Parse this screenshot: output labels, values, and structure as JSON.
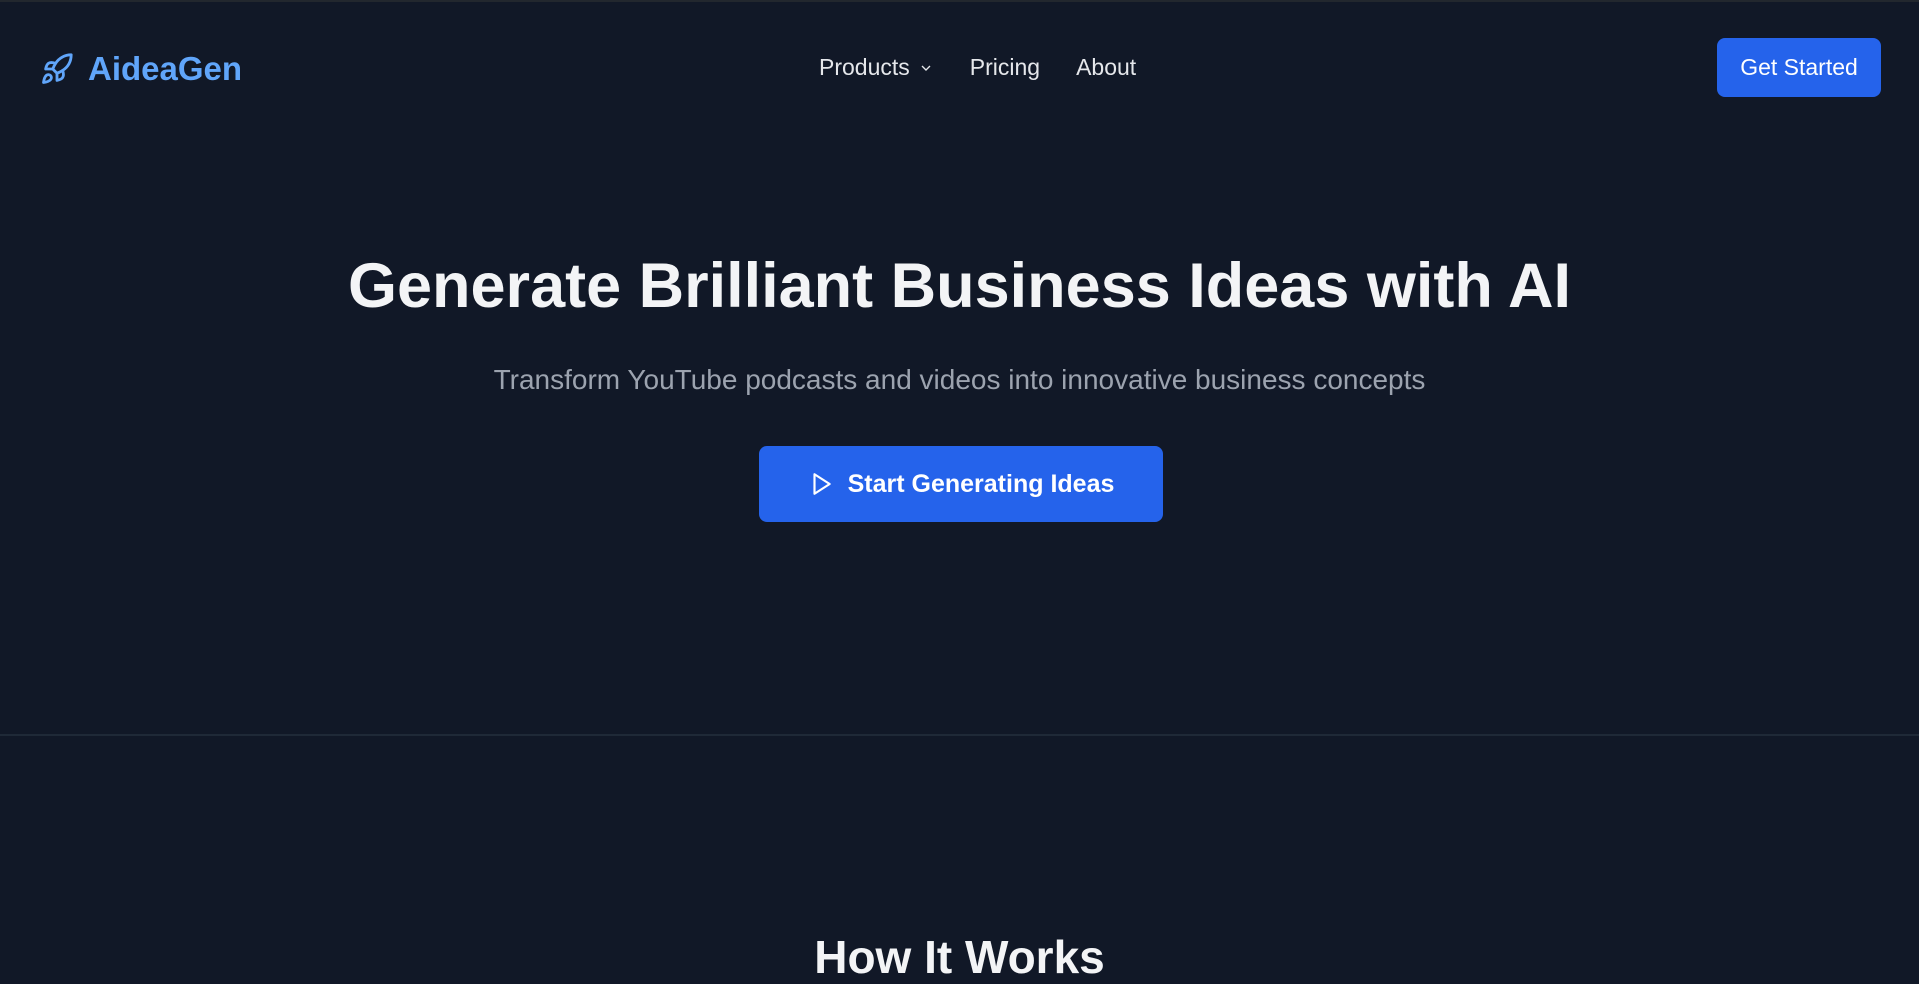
{
  "header": {
    "logo_text": "AideaGen",
    "logo_icon": "rocket-icon",
    "nav": [
      {
        "label": "Products",
        "icon": "chevron-down-icon"
      },
      {
        "label": "Pricing"
      },
      {
        "label": "About"
      }
    ],
    "cta_label": "Get Started"
  },
  "hero": {
    "title": "Generate Brilliant Business Ideas with AI",
    "subtitle": "Transform YouTube podcasts and videos into innovative business concepts",
    "cta_label": "Start Generating Ideas",
    "cta_icon": "play-icon"
  },
  "how_it_works": {
    "title": "How It Works"
  },
  "colors": {
    "background": "#111827",
    "accent": "#2563eb",
    "logo": "#60a5fa",
    "muted": "#9ca3af"
  }
}
